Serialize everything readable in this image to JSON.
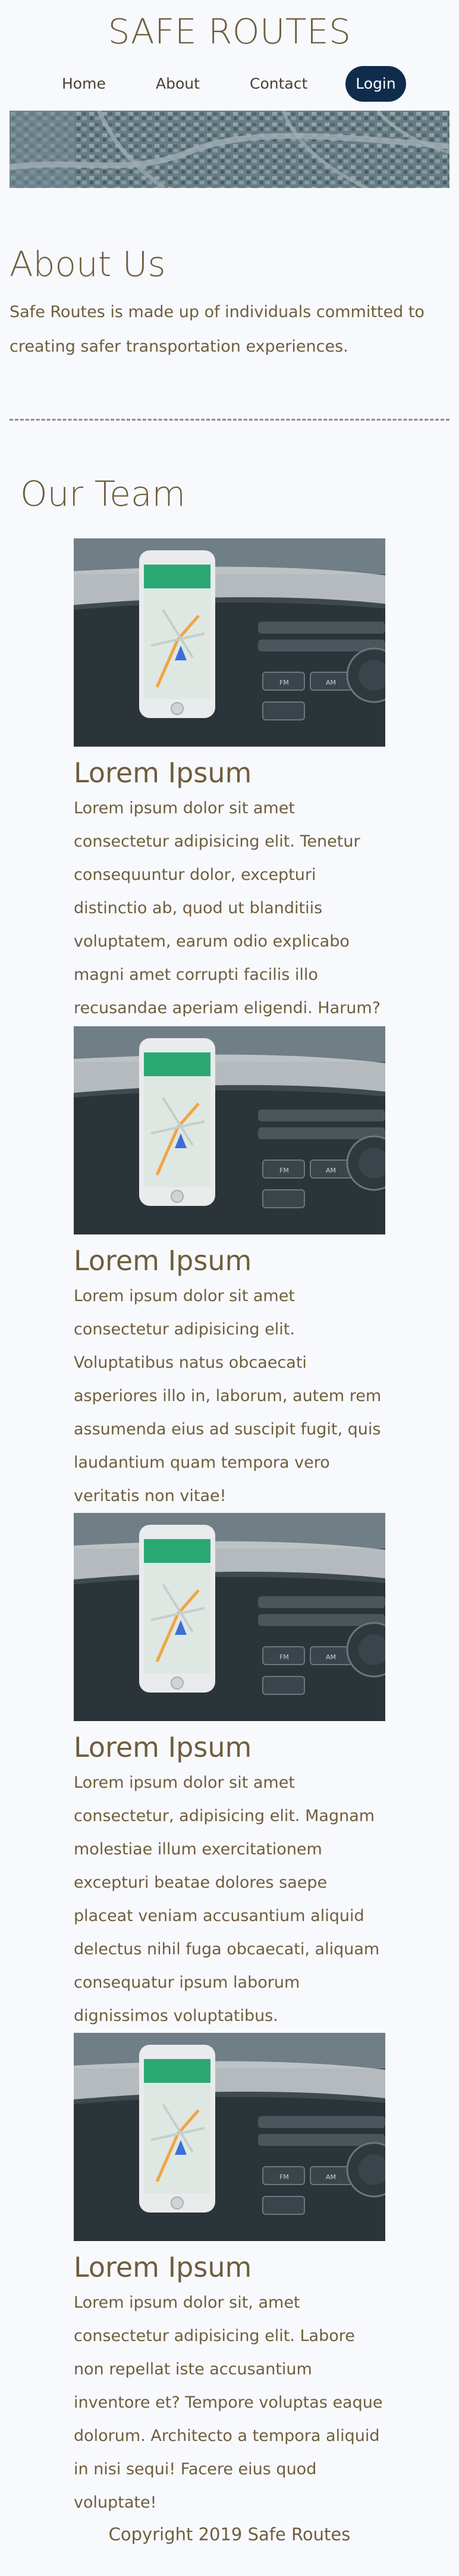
{
  "header": {
    "site_title": "SAFE ROUTES"
  },
  "nav": {
    "home": "Home",
    "about": "About",
    "contact": "Contact",
    "login": "Login"
  },
  "about": {
    "heading": "About Us",
    "text": "Safe Routes is made up of individuals committed to creating safer transportation experiences."
  },
  "team": {
    "heading": "Our Team",
    "members": [
      {
        "name": "Lorem Ipsum",
        "bio": "Lorem ipsum dolor sit amet consectetur adipisicing elit. Tenetur consequuntur dolor, excepturi distinctio ab, quod ut blanditiis voluptatem, earum odio explicabo magni amet corrupti facilis illo recusandae aperiam eligendi. Harum?"
      },
      {
        "name": "Lorem Ipsum",
        "bio": "Lorem ipsum dolor sit amet consectetur adipisicing elit. Voluptatibus natus obcaecati asperiores illo in, laborum, autem rem assumenda eius ad suscipit fugit, quis laudantium quam tempora vero veritatis non vitae!"
      },
      {
        "name": "Lorem Ipsum",
        "bio": "Lorem ipsum dolor sit amet consectetur, adipisicing elit. Magnam molestiae illum exercitationem excepturi beatae dolores saepe placeat veniam accusantium aliquid delectus nihil fuga obcaecati, aliquam consequatur ipsum laborum dignissimos voluptatibus."
      },
      {
        "name": "Lorem Ipsum",
        "bio": "Lorem ipsum dolor sit, amet consectetur adipisicing elit. Labore non repellat iste accusantium inventore et? Tempore voluptas eaque dolorum. Architecto a tempora aliquid in nisi sequi! Facere eius quod voluptate!"
      }
    ]
  },
  "footer": {
    "copyright": "Copyright 2019 Safe Routes"
  },
  "colors": {
    "text": "#6e5e3d",
    "login_bg": "#0f2c4d",
    "background": "#f8f9fd"
  }
}
